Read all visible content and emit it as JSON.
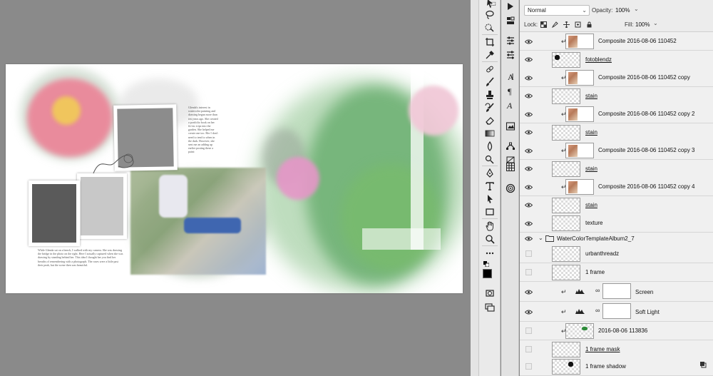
{
  "document": {
    "caption_right": "Glenda's interest in watercolor painting and drawing began more than ten years ago. She created a portfolio book on her fir-esc trips into the garden. She helped me create one too. Her I don't need to tend to when in the dark. However, she sent me an adding up earlier posting these a paint:",
    "caption_left": "While Glenda sat on a bench, I walked with my camera. She was drawing the bridge in the photo on the right. Here I actually captured when she was drawing by standing behind her. This idea I thought her you find her breaths of remembering with a photograph. The roses were a little past their peak, but the scene then was beautiful."
  },
  "layers_panel": {
    "blend_mode": "Normal",
    "opacity_label": "Opacity:",
    "opacity_value": "100%",
    "lock_label": "Lock:",
    "fill_label": "Fill:",
    "fill_value": "100%",
    "layers": [
      {
        "name": "Composite 2016-08-06 110452",
        "visible": true,
        "clipped": true,
        "thumb": "photo"
      },
      {
        "name": "fotoblendz",
        "visible": true,
        "underline": true,
        "thumb": "blob"
      },
      {
        "name": "Composite 2016-08-06 110452 copy",
        "visible": true,
        "clipped": true,
        "thumb": "photo"
      },
      {
        "name": "stain",
        "visible": true,
        "underline": true,
        "thumb": "checker"
      },
      {
        "name": "Composite 2016-08-06 110452 copy 2",
        "visible": true,
        "clipped": true,
        "thumb": "photo"
      },
      {
        "name": "stain",
        "visible": true,
        "underline": true,
        "thumb": "checker"
      },
      {
        "name": "Composite 2016-08-06 110452 copy 3",
        "visible": true,
        "clipped": true,
        "thumb": "photo"
      },
      {
        "name": "stain",
        "visible": true,
        "underline": true,
        "thumb": "checker"
      },
      {
        "name": "Composite 2016-08-06 110452 copy 4",
        "visible": true,
        "clipped": true,
        "thumb": "photo"
      },
      {
        "name": "stain",
        "visible": true,
        "underline": true,
        "thumb": "checker"
      },
      {
        "name": "texture",
        "visible": true,
        "thumb": "checker"
      },
      {
        "name": "WaterColorTemplateAlbum2_7",
        "visible": true,
        "group": true
      },
      {
        "name": "urbanthreadz",
        "visible": false,
        "thumb": "checker"
      },
      {
        "name": "1 frame",
        "visible": false,
        "thumb": "checker"
      },
      {
        "name": "Screen",
        "visible": true,
        "adjustment": true
      },
      {
        "name": "Soft Light",
        "visible": true,
        "adjustment": true
      },
      {
        "name": "2016-08-06 113836",
        "visible": false,
        "clipped": true,
        "thumb": "green"
      },
      {
        "name": "1 frame mask",
        "visible": false,
        "underline": true,
        "thumb": "checker"
      },
      {
        "name": "1 frame shadow",
        "visible": false,
        "thumb": "blob"
      }
    ]
  },
  "tools": [
    "move-tool",
    "lasso-tool",
    "quick-selection-tool",
    "crop-tool",
    "eyedropper-tool",
    "healing-brush-tool",
    "brush-tool",
    "clone-stamp-tool",
    "history-brush-tool",
    "eraser-tool",
    "gradient-tool",
    "blur-tool",
    "dodge-tool",
    "pen-tool",
    "type-tool",
    "path-selection-tool",
    "rectangle-tool",
    "hand-tool",
    "zoom-tool",
    "more-tools",
    "color-swatches",
    "quick-mask",
    "screen-mode"
  ],
  "dock": [
    "artboard-panel-icon",
    "layers-comp-icon",
    "paragraph-icon",
    "character-icon",
    "type-style-icon",
    "image-panel-icon",
    "path-icon",
    "table-icon",
    "creative-cloud-icon"
  ]
}
